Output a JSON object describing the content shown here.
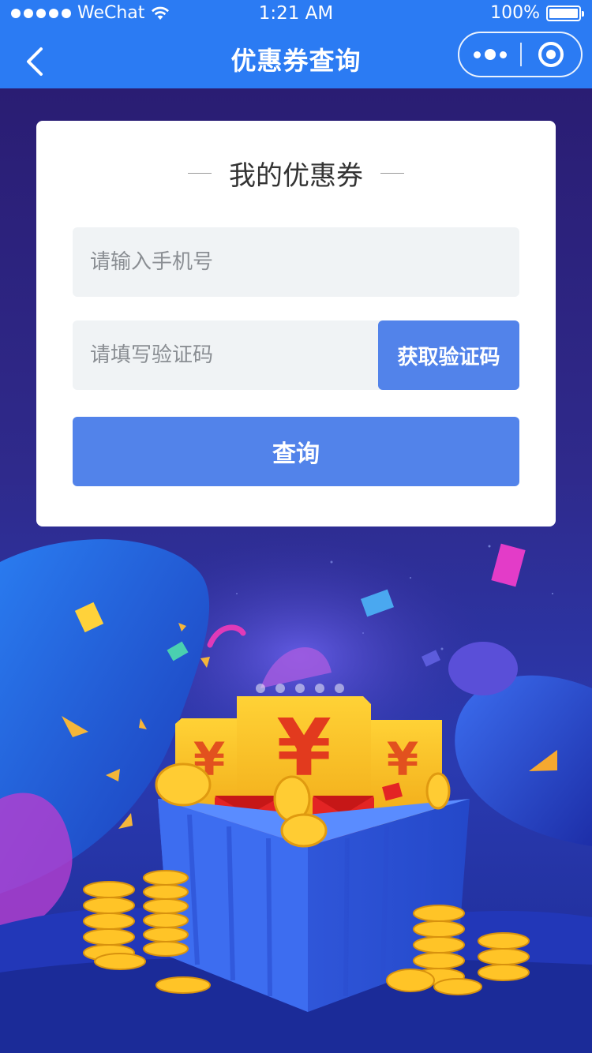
{
  "status_bar": {
    "carrier": "WeChat",
    "time": "1:21 AM",
    "battery": "100%"
  },
  "nav": {
    "title": "优惠券查询",
    "back_icon": "chevron-left-icon",
    "more_icon": "more-dots-icon",
    "close_icon": "target-circle-icon"
  },
  "card": {
    "title": "我的优惠券",
    "phone_placeholder": "请输入手机号",
    "phone_value": "",
    "code_placeholder": "请填写验证码",
    "code_value": "",
    "get_code_label": "获取验证码",
    "query_label": "查询"
  },
  "illustration": {
    "currency_symbol": "¥"
  },
  "colors": {
    "nav_bg": "#2b7bf3",
    "button": "#5283ea",
    "field_bg": "#f0f3f5"
  }
}
